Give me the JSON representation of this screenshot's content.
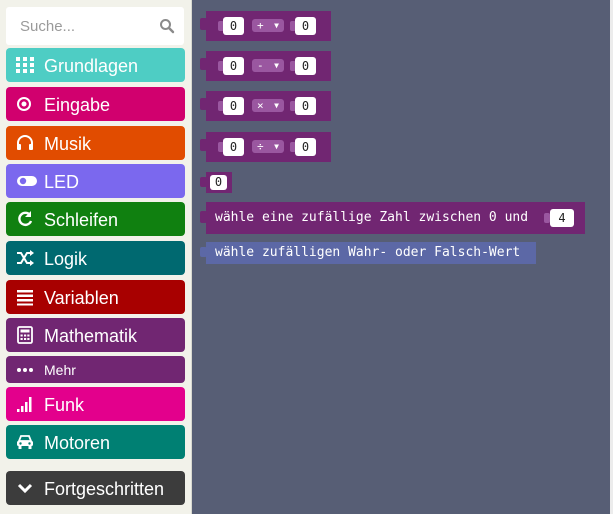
{
  "search": {
    "placeholder": "Suche..."
  },
  "categories": [
    {
      "label": "Grundlagen",
      "icon": "grid-icon",
      "color": "#4ecdc4"
    },
    {
      "label": "Eingabe",
      "icon": "radio-button-icon",
      "color": "#d1006e"
    },
    {
      "label": "Musik",
      "icon": "headphones-icon",
      "color": "#e14c00"
    },
    {
      "label": "LED",
      "icon": "toggle-icon",
      "color": "#7b68ee"
    },
    {
      "label": "Schleifen",
      "icon": "refresh-icon",
      "color": "#108010"
    },
    {
      "label": "Logik",
      "icon": "shuffle-icon",
      "color": "#006970"
    },
    {
      "label": "Variablen",
      "icon": "list-icon",
      "color": "#a80000"
    },
    {
      "label": "Mathematik",
      "icon": "calculator-icon",
      "color": "#712672"
    },
    {
      "label": "Mehr",
      "icon": "ellipsis-icon",
      "color": "#712672"
    },
    {
      "label": "Funk",
      "icon": "signal-icon",
      "color": "#e3008c"
    },
    {
      "label": "Motoren",
      "icon": "car-icon",
      "color": "#008073"
    },
    {
      "label": "Fortgeschritten",
      "icon": "chevron-down-icon",
      "color": "#3c3c3c"
    }
  ],
  "workspace": {
    "arith_blocks": [
      {
        "left": "0",
        "op": "+",
        "right": "0"
      },
      {
        "left": "0",
        "op": "-",
        "right": "0"
      },
      {
        "left": "0",
        "op": "×",
        "right": "0"
      },
      {
        "left": "0",
        "op": "÷",
        "right": "0"
      }
    ],
    "number_block": "0",
    "random_int_block": {
      "text": "wähle eine zufällige Zahl zwischen 0 und",
      "value": "4"
    },
    "random_bool_block": {
      "text": "wähle zufälligen Wahr- oder Falsch-Wert"
    },
    "colors": {
      "math": "#712672",
      "math_light": "#9a57a0",
      "logic_blue": "#5c68a6",
      "workspace": "#575e75"
    }
  }
}
